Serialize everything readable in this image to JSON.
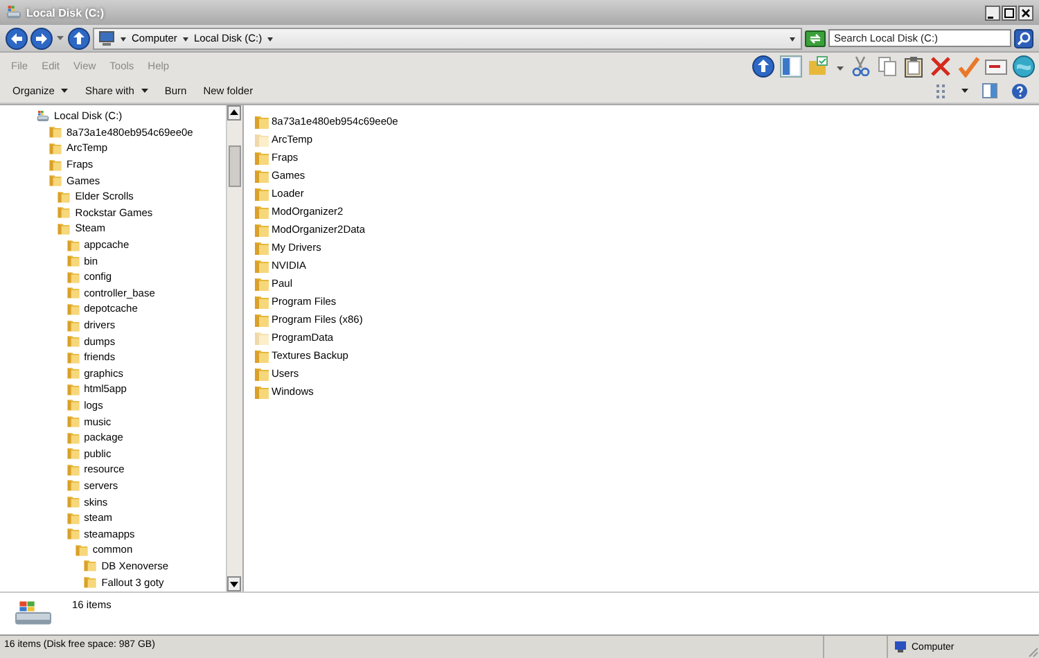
{
  "window": {
    "title": "Local Disk (C:)"
  },
  "address_bar": {
    "breadcrumbs": [
      "Computer",
      "Local Disk (C:)"
    ],
    "search": {
      "placeholder": "Search Local Disk (C:)"
    }
  },
  "menu_bar": [
    "File",
    "Edit",
    "View",
    "Tools",
    "Help"
  ],
  "command_bar": [
    {
      "label": "Organize",
      "dropdown": true
    },
    {
      "label": "Share with",
      "dropdown": true
    },
    {
      "label": "Burn",
      "dropdown": false
    },
    {
      "label": "New folder",
      "dropdown": false
    }
  ],
  "tree": [
    {
      "label": "Local Disk (C:)",
      "kind": "drive",
      "children": [
        {
          "label": "8a73a1e480eb954c69ee0e",
          "kind": "folder"
        },
        {
          "label": "ArcTemp",
          "kind": "folder"
        },
        {
          "label": "Fraps",
          "kind": "folder"
        },
        {
          "label": "Games",
          "kind": "folder",
          "children": [
            {
              "label": "Elder Scrolls",
              "kind": "folder"
            },
            {
              "label": "Rockstar Games",
              "kind": "folder"
            },
            {
              "label": "Steam",
              "kind": "folder",
              "children": [
                {
                  "label": "appcache",
                  "kind": "folder"
                },
                {
                  "label": "bin",
                  "kind": "folder"
                },
                {
                  "label": "config",
                  "kind": "folder"
                },
                {
                  "label": "controller_base",
                  "kind": "folder"
                },
                {
                  "label": "depotcache",
                  "kind": "folder"
                },
                {
                  "label": "drivers",
                  "kind": "folder"
                },
                {
                  "label": "dumps",
                  "kind": "folder"
                },
                {
                  "label": "friends",
                  "kind": "folder"
                },
                {
                  "label": "graphics",
                  "kind": "folder"
                },
                {
                  "label": "html5app",
                  "kind": "folder"
                },
                {
                  "label": "logs",
                  "kind": "folder"
                },
                {
                  "label": "music",
                  "kind": "folder"
                },
                {
                  "label": "package",
                  "kind": "folder"
                },
                {
                  "label": "public",
                  "kind": "folder"
                },
                {
                  "label": "resource",
                  "kind": "folder"
                },
                {
                  "label": "servers",
                  "kind": "folder"
                },
                {
                  "label": "skins",
                  "kind": "folder"
                },
                {
                  "label": "steam",
                  "kind": "folder"
                },
                {
                  "label": "steamapps",
                  "kind": "folder",
                  "children": [
                    {
                      "label": "common",
                      "kind": "folder",
                      "children": [
                        {
                          "label": "DB Xenoverse",
                          "kind": "folder"
                        },
                        {
                          "label": "Fallout 3 goty",
                          "kind": "folder"
                        }
                      ]
                    }
                  ]
                }
              ]
            }
          ]
        }
      ]
    }
  ],
  "files": [
    {
      "name": "8a73a1e480eb954c69ee0e",
      "hidden": false
    },
    {
      "name": "ArcTemp",
      "hidden": true
    },
    {
      "name": "Fraps",
      "hidden": false
    },
    {
      "name": "Games",
      "hidden": false
    },
    {
      "name": "Loader",
      "hidden": false
    },
    {
      "name": "ModOrganizer2",
      "hidden": false
    },
    {
      "name": "ModOrganizer2Data",
      "hidden": false
    },
    {
      "name": "My Drivers",
      "hidden": false
    },
    {
      "name": "NVIDIA",
      "hidden": false
    },
    {
      "name": "Paul",
      "hidden": false
    },
    {
      "name": "Program Files",
      "hidden": false
    },
    {
      "name": "Program Files (x86)",
      "hidden": false
    },
    {
      "name": "ProgramData",
      "hidden": true
    },
    {
      "name": "Textures Backup",
      "hidden": false
    },
    {
      "name": "Users",
      "hidden": false
    },
    {
      "name": "Windows",
      "hidden": false
    }
  ],
  "details_pane": {
    "summary": "16 items"
  },
  "status_bar": {
    "text": "16 items (Disk free space: 987 GB)",
    "zone": "Computer"
  }
}
